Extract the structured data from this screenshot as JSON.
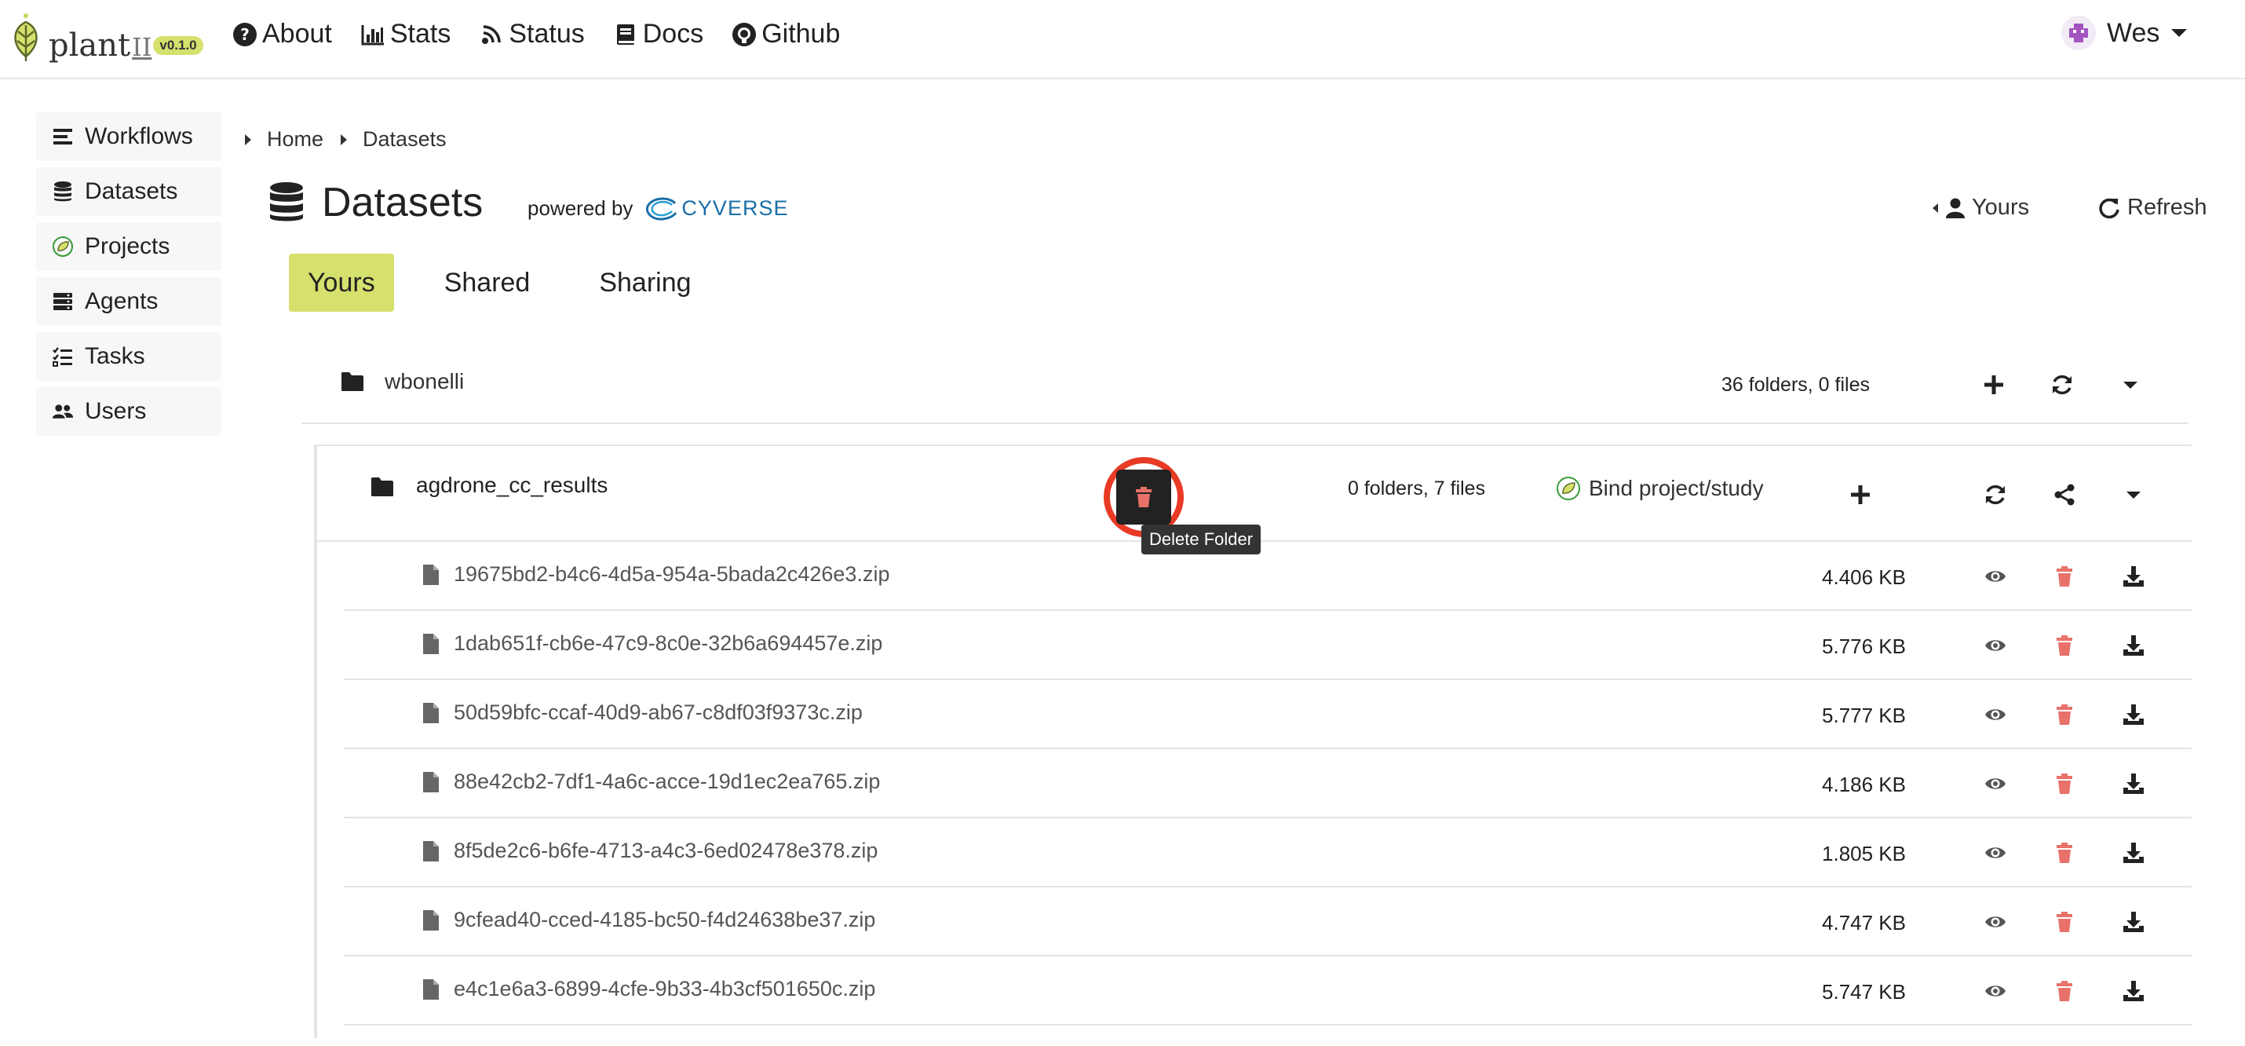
{
  "navbar": {
    "brand_name": "plant",
    "brand_suffix": "II",
    "version": "v0.1.0",
    "links": [
      {
        "label": "About",
        "icon": "question-circle-icon"
      },
      {
        "label": "Stats",
        "icon": "bar-chart-icon"
      },
      {
        "label": "Status",
        "icon": "broadcast-icon"
      },
      {
        "label": "Docs",
        "icon": "book-icon"
      },
      {
        "label": "Github",
        "icon": "github-icon"
      }
    ],
    "user": "Wes"
  },
  "sidebar": {
    "items": [
      {
        "label": "Workflows",
        "icon": "list-icon"
      },
      {
        "label": "Datasets",
        "icon": "database-icon"
      },
      {
        "label": "Projects",
        "icon": "leaf-icon"
      },
      {
        "label": "Agents",
        "icon": "server-icon"
      },
      {
        "label": "Tasks",
        "icon": "tasks-icon"
      },
      {
        "label": "Users",
        "icon": "users-icon"
      }
    ]
  },
  "breadcrumb": [
    "Home",
    "Datasets"
  ],
  "page": {
    "title": "Datasets",
    "powered_by": "powered by",
    "provider": "CYVERSE",
    "yours_toggle": "Yours",
    "refresh": "Refresh"
  },
  "tabs": [
    {
      "label": "Yours",
      "active": true
    },
    {
      "label": "Shared",
      "active": false
    },
    {
      "label": "Sharing",
      "active": false
    }
  ],
  "root_folder": {
    "name": "wbonelli",
    "count": "36 folders, 0 files"
  },
  "subfolder": {
    "name": "agdrone_cc_results",
    "count": "0 folders, 7 files",
    "bind_label": "Bind project/study",
    "tooltip": "Delete Folder"
  },
  "files": [
    {
      "name": "19675bd2-b4c6-4d5a-954a-5bada2c426e3.zip",
      "size": "4.406 KB"
    },
    {
      "name": "1dab651f-cb6e-47c9-8c0e-32b6a694457e.zip",
      "size": "5.776 KB"
    },
    {
      "name": "50d59bfc-ccaf-40d9-ab67-c8df03f9373c.zip",
      "size": "5.777 KB"
    },
    {
      "name": "88e42cb2-7df1-4a6c-acce-19d1ec2ea765.zip",
      "size": "4.186 KB"
    },
    {
      "name": "8f5de2c6-b6fe-4713-a4c3-6ed02478e378.zip",
      "size": "1.805 KB"
    },
    {
      "name": "9cfead40-cced-4185-bc50-f4d24638be37.zip",
      "size": "4.747 KB"
    },
    {
      "name": "e4c1e6a3-6899-4cfe-9b33-4b3cf501650c.zip",
      "size": "5.747 KB"
    }
  ],
  "colors": {
    "accent": "#d6e06d",
    "danger": "#e8716a",
    "highlight_ring": "#e83a24"
  }
}
